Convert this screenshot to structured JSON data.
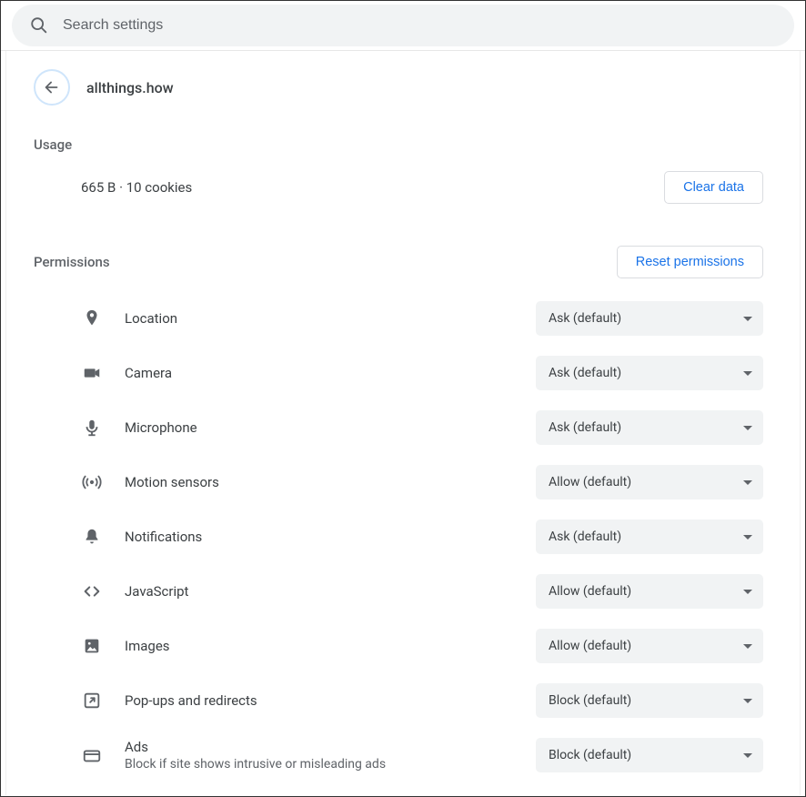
{
  "search": {
    "placeholder": "Search settings"
  },
  "header": {
    "site_title": "allthings.how"
  },
  "usage": {
    "heading": "Usage",
    "summary": "665 B · 10 cookies",
    "clear_button": "Clear data"
  },
  "permissions": {
    "heading": "Permissions",
    "reset_button": "Reset permissions",
    "items": [
      {
        "icon": "location-icon",
        "label": "Location",
        "sublabel": "",
        "value": "Ask (default)"
      },
      {
        "icon": "camera-icon",
        "label": "Camera",
        "sublabel": "",
        "value": "Ask (default)"
      },
      {
        "icon": "microphone-icon",
        "label": "Microphone",
        "sublabel": "",
        "value": "Ask (default)"
      },
      {
        "icon": "motion-sensors-icon",
        "label": "Motion sensors",
        "sublabel": "",
        "value": "Allow (default)"
      },
      {
        "icon": "notifications-icon",
        "label": "Notifications",
        "sublabel": "",
        "value": "Ask (default)"
      },
      {
        "icon": "javascript-icon",
        "label": "JavaScript",
        "sublabel": "",
        "value": "Allow (default)"
      },
      {
        "icon": "images-icon",
        "label": "Images",
        "sublabel": "",
        "value": "Allow (default)"
      },
      {
        "icon": "popups-icon",
        "label": "Pop-ups and redirects",
        "sublabel": "",
        "value": "Block (default)"
      },
      {
        "icon": "ads-icon",
        "label": "Ads",
        "sublabel": "Block if site shows intrusive or misleading ads",
        "value": "Block (default)"
      }
    ]
  }
}
